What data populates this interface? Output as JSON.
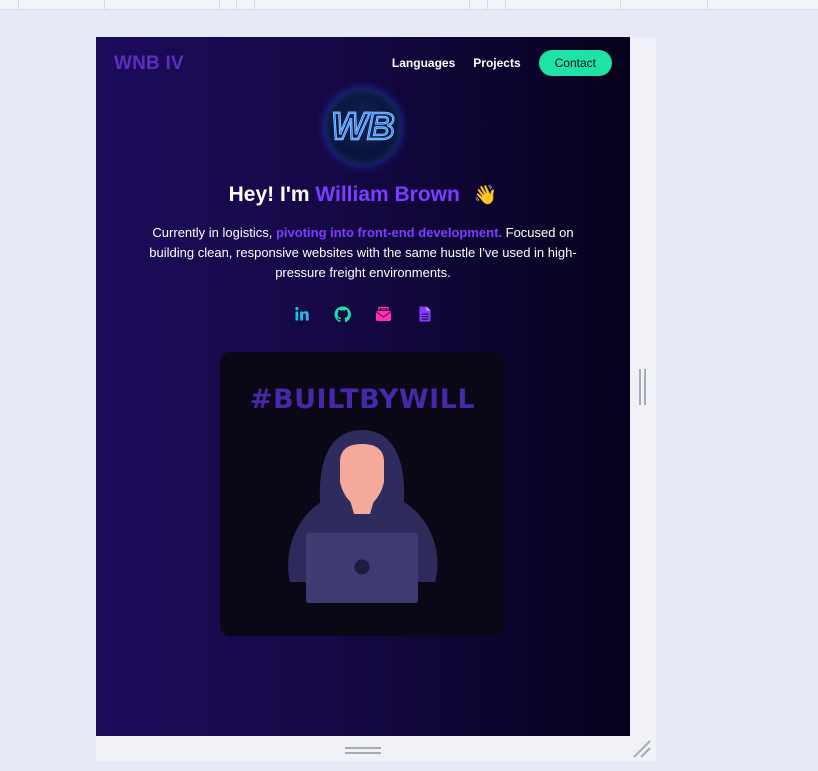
{
  "header": {
    "brand": "WNB IV",
    "nav": {
      "languages": "Languages",
      "projects": "Projects",
      "contact": "Contact"
    }
  },
  "hero": {
    "logo_text": "WB",
    "greeting": "Hey! I'm",
    "name": "William Brown",
    "wave_emoji": "👋",
    "bio_start": "Currently in logistics, ",
    "bio_highlight": "pivoting into front-end development.",
    "bio_end": " Focused on building clean, responsive websites with the same hustle I've used in high-pressure freight environments."
  },
  "socials": {
    "linkedin": {
      "icon": "linkedin-icon",
      "color": "#17c2e8"
    },
    "github": {
      "icon": "github-icon",
      "color": "#1fe3a5"
    },
    "email": {
      "icon": "email-icon",
      "color": "#ff2fb4"
    },
    "resume": {
      "icon": "document-icon",
      "color": "#8a3dff"
    }
  },
  "feature_card": {
    "hashtag": "#BUILTBYWILL",
    "image": "hooded-coder-illustration"
  },
  "colors": {
    "accent_purple": "#7b3dff",
    "contact_green": "#1fe3a5",
    "brand_purple": "#5a2fc0"
  }
}
